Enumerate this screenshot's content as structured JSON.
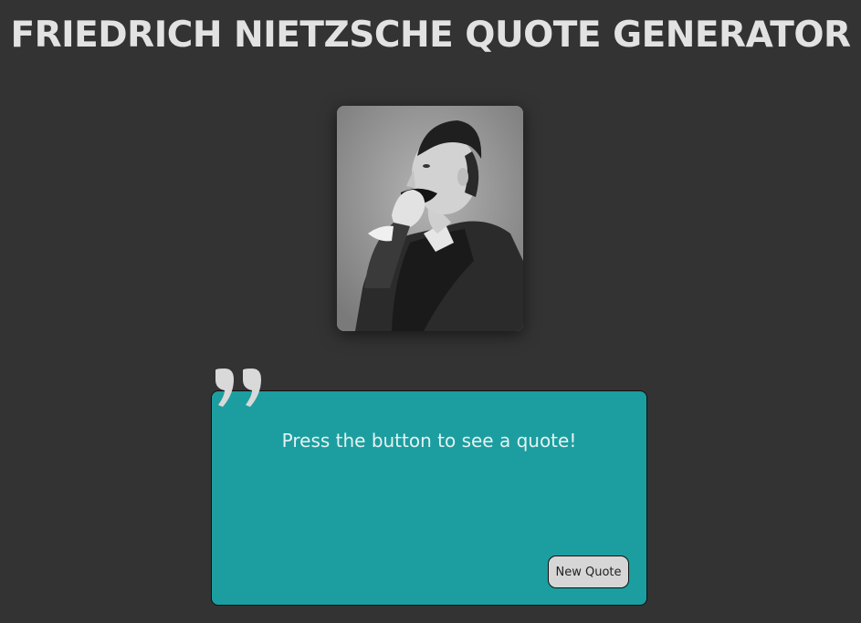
{
  "page": {
    "title": "FRIEDRICH NIETZSCHE QUOTE GENERATOR"
  },
  "portrait": {
    "alt": "Portrait photograph of Friedrich Nietzsche"
  },
  "quote": {
    "text": "Press the button to see a quote!",
    "button_label": "New Quote",
    "icon": "quote-mark-icon"
  },
  "colors": {
    "background": "#333333",
    "title": "#e2e2e2",
    "card": "#1c9ea0",
    "button": "#d6d6d6"
  }
}
